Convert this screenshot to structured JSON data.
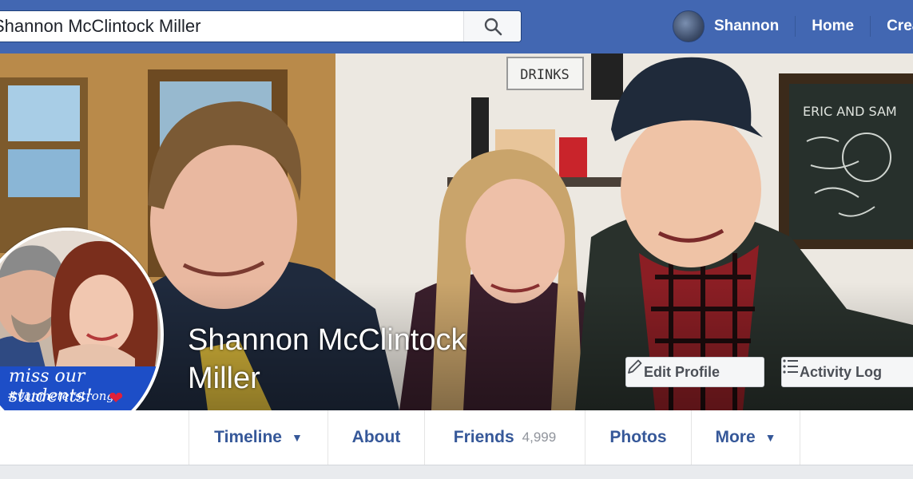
{
  "search": {
    "value": "Shannon McClintock Miller",
    "placeholder": "Search"
  },
  "nav": {
    "user_name": "Shannon",
    "home": "Home",
    "create": "Create"
  },
  "profile": {
    "name": "Shannon McClintock Miller",
    "picture_text_1": "miss our students!",
    "picture_text_2": "#vanmeterstrong",
    "edit_profile": "Edit Profile",
    "activity_log": "Activity Log"
  },
  "cover": {
    "sign_drinks": "DRINKS",
    "chalkboard_text": "ERIC AND SAM"
  },
  "tabs": [
    {
      "label": "Timeline",
      "has_dropdown": true
    },
    {
      "label": "About"
    },
    {
      "label": "Friends",
      "count": "4,999"
    },
    {
      "label": "Photos"
    },
    {
      "label": "More",
      "has_dropdown": true
    }
  ],
  "colors": {
    "brand": "#4267b2",
    "link": "#365899",
    "page_bg": "#e9ebee"
  },
  "icons": [
    "search-icon",
    "pencil-icon",
    "list-icon",
    "caret-down-icon"
  ]
}
